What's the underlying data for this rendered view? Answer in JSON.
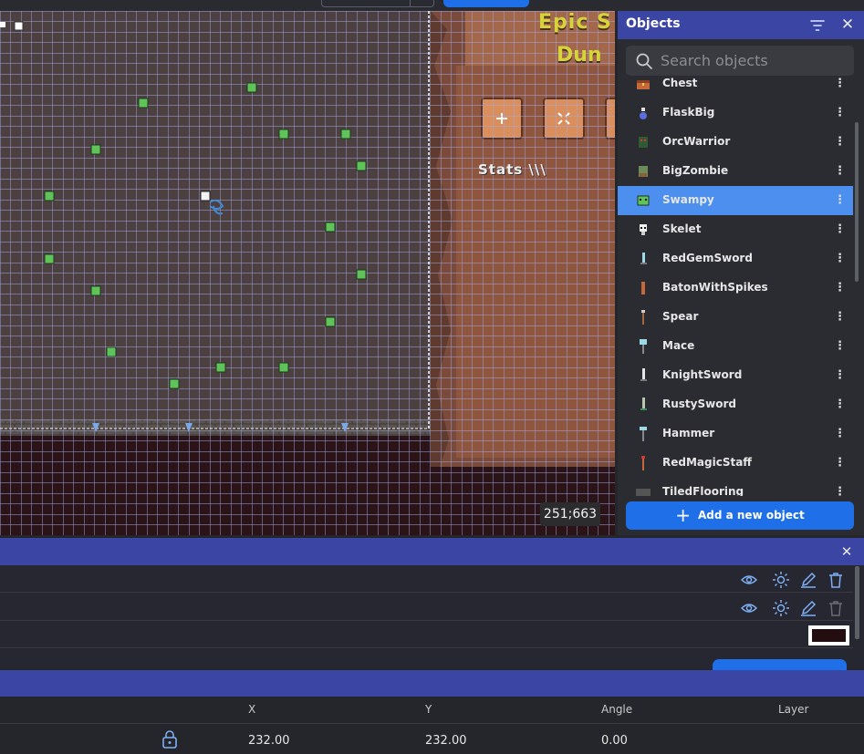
{
  "scene": {
    "coordinates": "251;663",
    "game_title_line1": "Epic S",
    "game_title_line2": "Dun",
    "stats_label": "Stats \\\\\\"
  },
  "objects_panel": {
    "title": "Objects",
    "search_placeholder": "Search objects",
    "selected": "Swampy",
    "items": [
      {
        "label": "Chest",
        "icon": "chest-icon"
      },
      {
        "label": "FlaskBig",
        "icon": "flask-icon"
      },
      {
        "label": "OrcWarrior",
        "icon": "orc-icon"
      },
      {
        "label": "BigZombie",
        "icon": "zombie-icon"
      },
      {
        "label": "Swampy",
        "icon": "swampy-icon"
      },
      {
        "label": "Skelet",
        "icon": "skeleton-icon"
      },
      {
        "label": "RedGemSword",
        "icon": "sword-icon"
      },
      {
        "label": "BatonWithSpikes",
        "icon": "baton-icon"
      },
      {
        "label": "Spear",
        "icon": "spear-icon"
      },
      {
        "label": "Mace",
        "icon": "mace-icon"
      },
      {
        "label": "KnightSword",
        "icon": "sword-icon"
      },
      {
        "label": "RustySword",
        "icon": "sword-icon"
      },
      {
        "label": "Hammer",
        "icon": "hammer-icon"
      },
      {
        "label": "RedMagicStaff",
        "icon": "staff-icon"
      },
      {
        "label": "TiledFlooring",
        "icon": "floor-icon"
      }
    ],
    "add_button_label": "Add a new object"
  },
  "layers_panel": {
    "background_color": "#230d10"
  },
  "properties_panel": {
    "columns": {
      "x": "X",
      "y": "Y",
      "angle": "Angle",
      "layer": "Layer"
    },
    "values": {
      "x": "232.00",
      "y": "232.00",
      "angle": "0.00"
    }
  },
  "colors": {
    "accent": "#1e6fe8",
    "panel_header": "#3b45a4",
    "selection": "#4c8fee"
  }
}
